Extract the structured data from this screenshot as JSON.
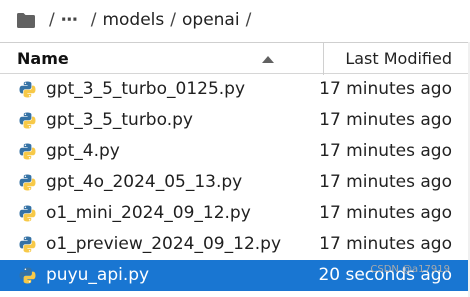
{
  "breadcrumb": {
    "ellipsis": "⋯",
    "separator": "/",
    "segments": [
      "models",
      "openai"
    ]
  },
  "header": {
    "name_label": "Name",
    "modified_label": "Last Modified",
    "sort": "ascending"
  },
  "files": [
    {
      "name": "gpt_3_5_turbo_0125.py",
      "modified": "17 minutes ago",
      "icon": "python-icon"
    },
    {
      "name": "gpt_3_5_turbo.py",
      "modified": "17 minutes ago",
      "icon": "python-icon"
    },
    {
      "name": "gpt_4.py",
      "modified": "17 minutes ago",
      "icon": "python-icon"
    },
    {
      "name": "gpt_4o_2024_05_13.py",
      "modified": "17 minutes ago",
      "icon": "python-icon"
    },
    {
      "name": "o1_mini_2024_09_12.py",
      "modified": "17 minutes ago",
      "icon": "python-icon"
    },
    {
      "name": "o1_preview_2024_09_12.py",
      "modified": "17 minutes ago",
      "icon": "python-icon"
    },
    {
      "name": "puyu_api.py",
      "modified": "20 seconds ago",
      "icon": "python-icon",
      "selected": true
    }
  ],
  "watermark": "CSDN @a17919",
  "colors": {
    "selection": "#1976d2",
    "python_blue": "#3572a5",
    "python_yellow": "#f7c948",
    "folder": "#616161"
  }
}
